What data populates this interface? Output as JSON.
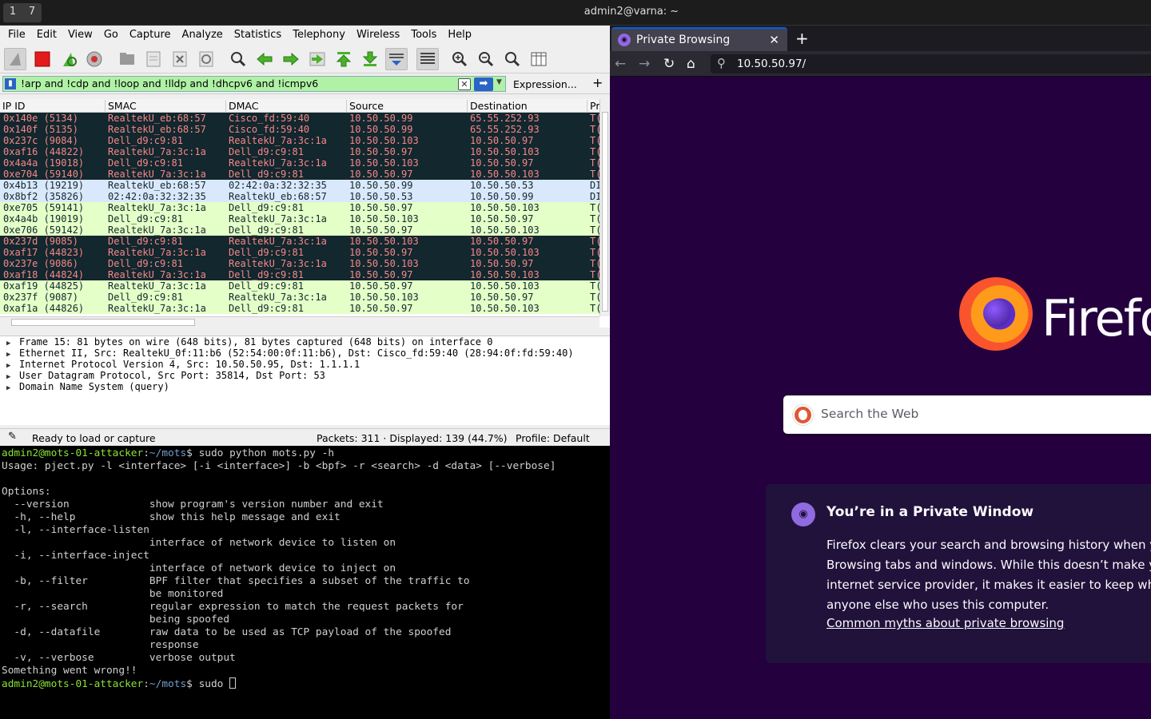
{
  "topbar": {
    "workspaces": [
      "1",
      "7"
    ],
    "window_title": "admin2@varna: ~"
  },
  "wireshark": {
    "menu": [
      "File",
      "Edit",
      "View",
      "Go",
      "Capture",
      "Analyze",
      "Statistics",
      "Telephony",
      "Wireless",
      "Tools",
      "Help"
    ],
    "filter": {
      "value": "!arp and !cdp and !loop and !lldp and !dhcpv6 and !icmpv6",
      "expression_label": "Expression...",
      "add_label": "+"
    },
    "columns": [
      "IP ID",
      "SMAC",
      "DMAC",
      "Source",
      "Destination",
      "Pr"
    ],
    "rows": [
      {
        "style": "dark",
        "ipid": "0x140e (5134)",
        "smac": "RealtekU_eb:68:57",
        "dmac": "Cisco_fd:59:40",
        "src": "10.50.50.99",
        "dst": "65.55.252.93",
        "proto": "T("
      },
      {
        "style": "dark",
        "ipid": "0x140f (5135)",
        "smac": "RealtekU_eb:68:57",
        "dmac": "Cisco_fd:59:40",
        "src": "10.50.50.99",
        "dst": "65.55.252.93",
        "proto": "T("
      },
      {
        "style": "dark",
        "ipid": "0x237c (9084)",
        "smac": "Dell_d9:c9:81",
        "dmac": "RealtekU_7a:3c:1a",
        "src": "10.50.50.103",
        "dst": "10.50.50.97",
        "proto": "T("
      },
      {
        "style": "dark",
        "ipid": "0xaf16 (44822)",
        "smac": "RealtekU_7a:3c:1a",
        "dmac": "Dell_d9:c9:81",
        "src": "10.50.50.97",
        "dst": "10.50.50.103",
        "proto": "T("
      },
      {
        "style": "dark",
        "ipid": "0x4a4a (19018)",
        "smac": "Dell_d9:c9:81",
        "dmac": "RealtekU_7a:3c:1a",
        "src": "10.50.50.103",
        "dst": "10.50.50.97",
        "proto": "T("
      },
      {
        "style": "dark",
        "ipid": "0xe704 (59140)",
        "smac": "RealtekU_7a:3c:1a",
        "dmac": "Dell_d9:c9:81",
        "src": "10.50.50.97",
        "dst": "10.50.50.103",
        "proto": "T("
      },
      {
        "style": "blue",
        "ipid": "0x4b13 (19219)",
        "smac": "RealtekU_eb:68:57",
        "dmac": "02:42:0a:32:32:35",
        "src": "10.50.50.99",
        "dst": "10.50.50.53",
        "proto": "DI"
      },
      {
        "style": "blue",
        "ipid": "0x8bf2 (35826)",
        "smac": "02:42:0a:32:32:35",
        "dmac": "RealtekU_eb:68:57",
        "src": "10.50.50.53",
        "dst": "10.50.50.99",
        "proto": "DI"
      },
      {
        "style": "green",
        "ipid": "0xe705 (59141)",
        "smac": "RealtekU_7a:3c:1a",
        "dmac": "Dell_d9:c9:81",
        "src": "10.50.50.97",
        "dst": "10.50.50.103",
        "proto": "T("
      },
      {
        "style": "green",
        "ipid": "0x4a4b (19019)",
        "smac": "Dell_d9:c9:81",
        "dmac": "RealtekU_7a:3c:1a",
        "src": "10.50.50.103",
        "dst": "10.50.50.97",
        "proto": "T("
      },
      {
        "style": "green",
        "ipid": "0xe706 (59142)",
        "smac": "RealtekU_7a:3c:1a",
        "dmac": "Dell_d9:c9:81",
        "src": "10.50.50.97",
        "dst": "10.50.50.103",
        "proto": "T("
      },
      {
        "style": "dark",
        "ipid": "0x237d (9085)",
        "smac": "Dell_d9:c9:81",
        "dmac": "RealtekU_7a:3c:1a",
        "src": "10.50.50.103",
        "dst": "10.50.50.97",
        "proto": "T("
      },
      {
        "style": "dark",
        "ipid": "0xaf17 (44823)",
        "smac": "RealtekU_7a:3c:1a",
        "dmac": "Dell_d9:c9:81",
        "src": "10.50.50.97",
        "dst": "10.50.50.103",
        "proto": "T("
      },
      {
        "style": "dark",
        "ipid": "0x237e (9086)",
        "smac": "Dell_d9:c9:81",
        "dmac": "RealtekU_7a:3c:1a",
        "src": "10.50.50.103",
        "dst": "10.50.50.97",
        "proto": "T("
      },
      {
        "style": "dark",
        "ipid": "0xaf18 (44824)",
        "smac": "RealtekU_7a:3c:1a",
        "dmac": "Dell_d9:c9:81",
        "src": "10.50.50.97",
        "dst": "10.50.50.103",
        "proto": "T("
      },
      {
        "style": "green",
        "ipid": "0xaf19 (44825)",
        "smac": "RealtekU_7a:3c:1a",
        "dmac": "Dell_d9:c9:81",
        "src": "10.50.50.97",
        "dst": "10.50.50.103",
        "proto": "T("
      },
      {
        "style": "green",
        "ipid": "0x237f (9087)",
        "smac": "Dell_d9:c9:81",
        "dmac": "RealtekU_7a:3c:1a",
        "src": "10.50.50.103",
        "dst": "10.50.50.97",
        "proto": "T("
      },
      {
        "style": "green",
        "ipid": "0xaf1a (44826)",
        "smac": "RealtekU_7a:3c:1a",
        "dmac": "Dell_d9:c9:81",
        "src": "10.50.50.97",
        "dst": "10.50.50.103",
        "proto": "T("
      }
    ],
    "details": [
      "Frame 15: 81 bytes on wire (648 bits), 81 bytes captured (648 bits) on interface 0",
      "Ethernet II, Src: RealtekU_0f:11:b6 (52:54:00:0f:11:b6), Dst: Cisco_fd:59:40 (28:94:0f:fd:59:40)",
      "Internet Protocol Version 4, Src: 10.50.50.95, Dst: 1.1.1.1",
      "User Datagram Protocol, Src Port: 35814, Dst Port: 53",
      "Domain Name System (query)"
    ],
    "status": {
      "ready": "Ready to load or capture",
      "packets": "Packets: 311 · Displayed: 139 (44.7%)",
      "profile": "Profile: Default"
    },
    "colors": {
      "dark_bg": "#12272e",
      "dark_fg": "#f78787",
      "blue_bg": "#dae8fc",
      "green_bg": "#e4ffc7",
      "filter_bg": "#b0f2a5"
    },
    "toolbar_icons": [
      "shark-fin-start-icon",
      "stop-capture-icon",
      "restart-capture-icon",
      "capture-options-icon",
      "open-file-icon",
      "save-file-icon",
      "close-file-icon",
      "reload-file-icon",
      "find-packet-icon",
      "go-back-icon",
      "go-forward-icon",
      "go-to-packet-icon",
      "go-first-icon",
      "go-last-icon",
      "autoscroll-icon",
      "colorize-icon",
      "zoom-in-icon",
      "zoom-out-icon",
      "zoom-normal-icon",
      "resize-columns-icon"
    ]
  },
  "terminal": {
    "prompt_user": "admin2@mots-01-attacker",
    "prompt_path": "~/mots",
    "cmd1": "$ sudo python mots.py -h",
    "lines": [
      "Usage: pject.py -l <interface> [-i <interface>] -b <bpf> -r <search> -d <data> [--verbose]",
      "",
      "Options:",
      "  --version             show program's version number and exit",
      "  -h, --help            show this help message and exit",
      "  -l, --interface-listen",
      "                        interface of network device to listen on",
      "  -i, --interface-inject",
      "                        interface of network device to inject on",
      "  -b, --filter          BPF filter that specifies a subset of the traffic to",
      "                        be monitored",
      "  -r, --search          regular expression to match the request packets for",
      "                        being spoofed",
      "  -d, --datafile        raw data to be used as TCP payload of the spoofed",
      "                        response",
      "  -v, --verbose         verbose output",
      "Something went wrong!!"
    ],
    "cmd2": "$ sudo "
  },
  "firefox": {
    "tab_title": "Private Browsing",
    "url": "10.50.50.97/",
    "wordmark": "Firefox",
    "search_placeholder": "Search the Web",
    "card_title": "You’re in a Private Window",
    "card_lines": [
      "Firefox clears your search and browsing history when y",
      "Browsing tabs and windows. While this doesn’t make y",
      "internet service provider, it makes it easier to keep wha",
      "anyone else who uses this computer."
    ],
    "card_link": "Common myths about private browsing",
    "colors": {
      "page_bg": "#25003e",
      "card_bg": "#20123a",
      "accent": "#8f6ae0"
    }
  }
}
